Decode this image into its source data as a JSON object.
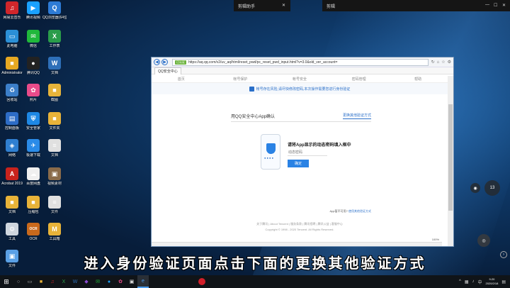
{
  "topbar": {
    "left_title": "剪辑助手",
    "right_title": "剪辑"
  },
  "desktop_icons": [
    {
      "label": "网易云音乐",
      "color": "#d0262b",
      "glyph": "♫"
    },
    {
      "label": "腾讯视频",
      "color": "#1aa1ff",
      "glyph": "▶"
    },
    {
      "label": "QQ浏览器(64位)",
      "color": "#2d7bd6",
      "glyph": "Q"
    },
    {
      "label": "此电脑",
      "color": "#2b8fd6",
      "glyph": "▭"
    },
    {
      "label": "微信",
      "color": "#20b83b",
      "glyph": "✉"
    },
    {
      "label": "工作表",
      "color": "#2a9c4a",
      "glyph": "X"
    },
    {
      "label": "Administrator",
      "color": "#e6a822",
      "glyph": "■"
    },
    {
      "label": "腾讯QQ",
      "color": "#222222",
      "glyph": "●"
    },
    {
      "label": "文档",
      "color": "#2e6fb8",
      "glyph": "W"
    },
    {
      "label": "回收站",
      "color": "#3c7fc9",
      "glyph": "♻"
    },
    {
      "label": "照片",
      "color": "#e84b8a",
      "glyph": "✿"
    },
    {
      "label": "截图",
      "color": "#e7b43a",
      "glyph": "■"
    },
    {
      "label": "控制面板",
      "color": "#2d6cc6",
      "glyph": "▤"
    },
    {
      "label": "安全管家",
      "color": "#1e88e5",
      "glyph": "⛨"
    },
    {
      "label": "文件夹",
      "color": "#e8b339",
      "glyph": "■"
    },
    {
      "label": "网络",
      "color": "#2f7fd1",
      "glyph": "◈"
    },
    {
      "label": "极速下载",
      "color": "#2a8be8",
      "glyph": "✈"
    },
    {
      "label": "文档",
      "color": "#e0e0e0",
      "glyph": "≡"
    },
    {
      "label": "Acrobat 2019",
      "color": "#c8231d",
      "glyph": "A"
    },
    {
      "label": "百度网盘",
      "color": "#f0f0f0",
      "glyph": "☁"
    },
    {
      "label": "视频素材",
      "color": "#8a6b4a",
      "glyph": "▣"
    },
    {
      "label": "文档",
      "color": "#e8b339",
      "glyph": "■"
    },
    {
      "label": "压缩包",
      "color": "#e8b339",
      "glyph": "■"
    },
    {
      "label": "文件",
      "color": "#e0e0e0",
      "glyph": "≡"
    },
    {
      "label": "工具",
      "color": "#cfd6de",
      "glyph": "⚙"
    },
    {
      "label": "OCR",
      "color": "#c9691c",
      "glyph": "OCR"
    },
    {
      "label": "工具箱",
      "color": "#e8b339",
      "glyph": "M"
    },
    {
      "label": "文件",
      "color": "#5aa0e6",
      "glyph": "▣"
    }
  ],
  "browser": {
    "url_tag": "已认证",
    "url": "https://aq.qq.com/v2/uv_aq/html/reset_pwd/pc_reset_pwd_input.html?v=3.0&old_ver_account=",
    "tab_title": "QQ安全中心",
    "top_nav": [
      "首页",
      "帐号保护",
      "帐号安全",
      "密码管理",
      "帮助"
    ],
    "notice": "帐号存在风险,请尽快修改密码,本次操作需要您进行身份验证",
    "card_title": "用QQ安全中心App确认",
    "alt_method": "更换其他验证方式",
    "prompt": "请将App显示的动态密码填入框中",
    "code_placeholder": "动态密码",
    "ok_button": "确定",
    "app_note_prefix": "App暂不可用?",
    "app_note_link": "使用其他验证方式",
    "footer_links": "关于腾讯 | About Tencent | 服务条款 | 腾讯招聘 | 腾讯公益 | 客服中心",
    "footer_copy": "Copyright © 1998 - 2020 Tencent. All Rights Reserved.",
    "zoom": "100%"
  },
  "bubble_label": "13",
  "subtitle": "进入身份验证页面点击下面的更换其他验证方式",
  "clock": {
    "time": "9:20",
    "date": "2020/2/18"
  }
}
